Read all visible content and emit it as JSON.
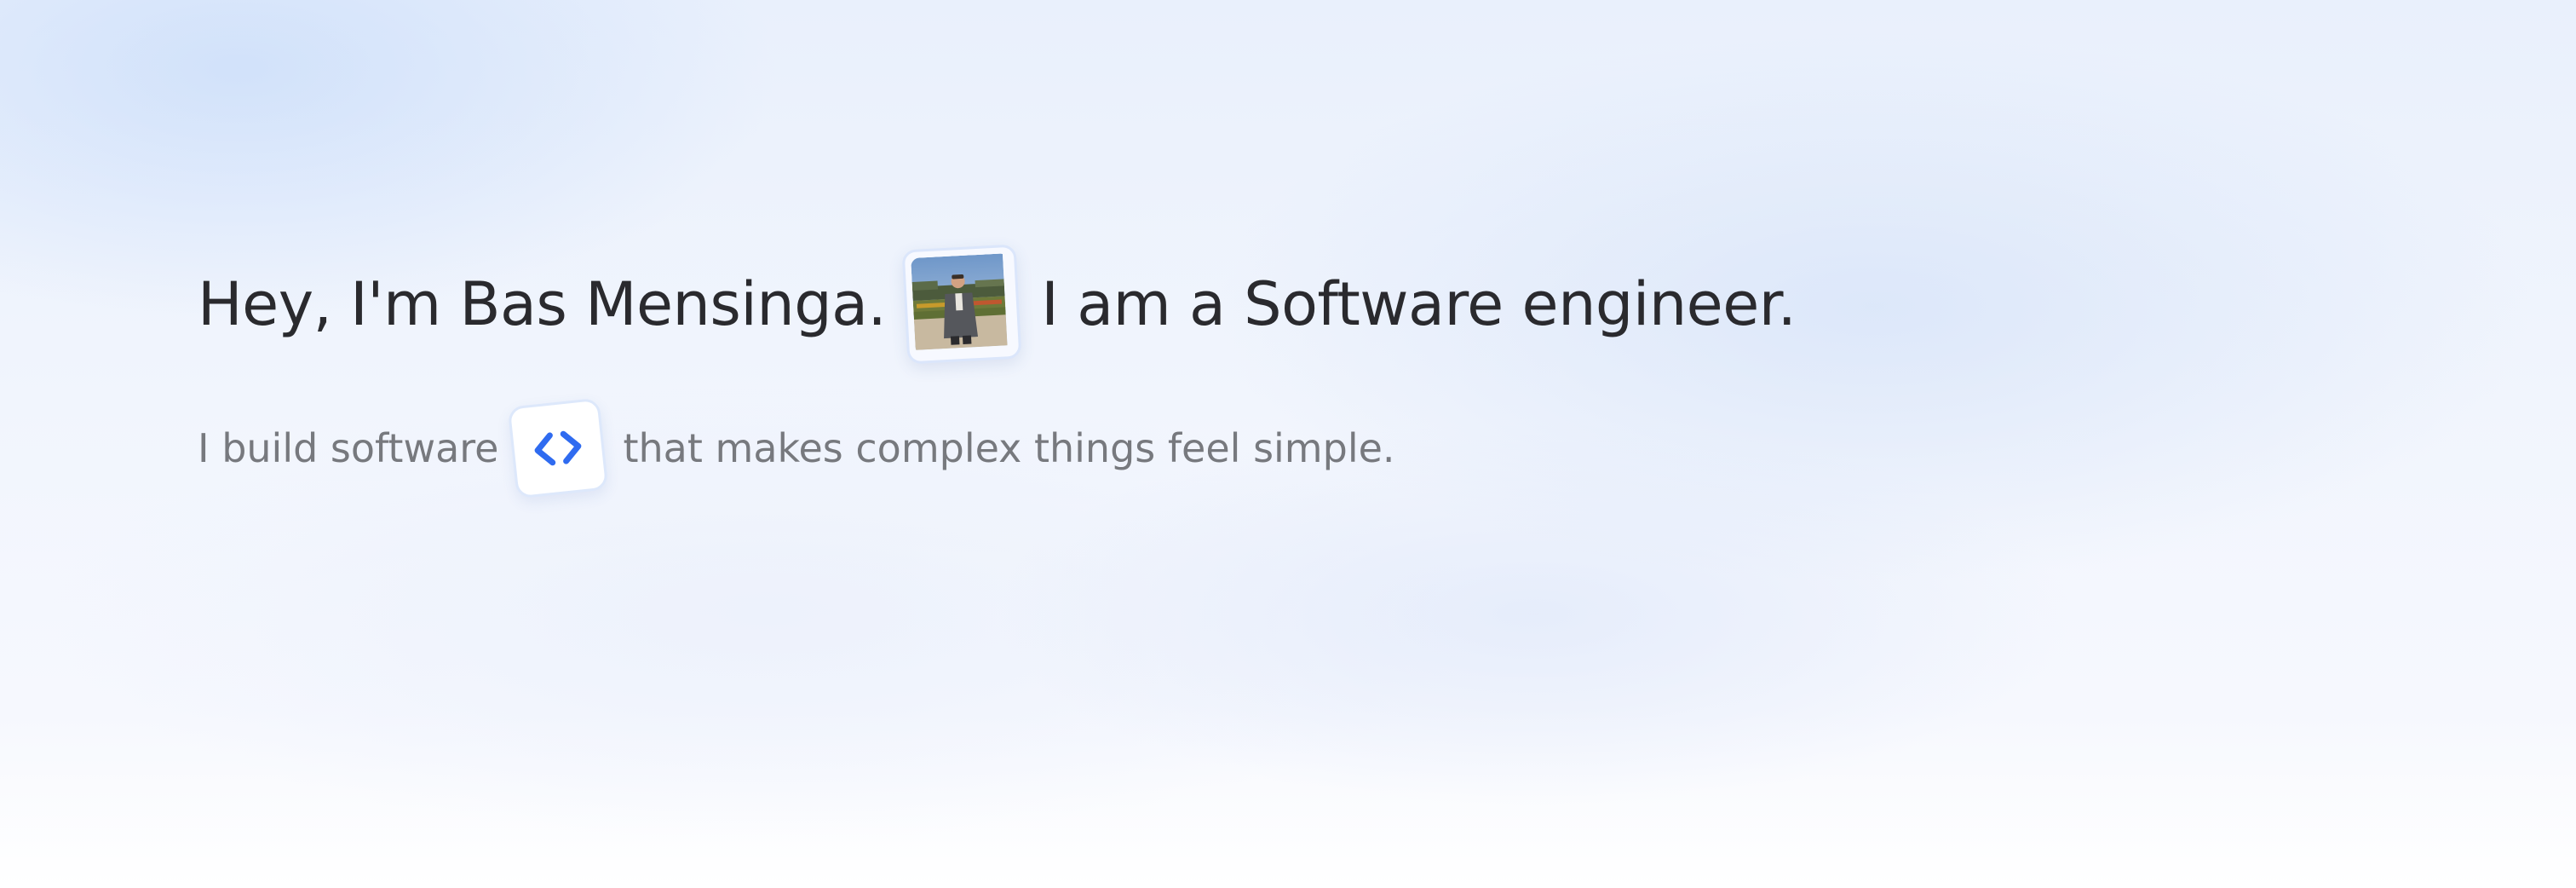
{
  "hero": {
    "greeting": "Hey, I'm Bas Mensinga.",
    "role": "I am a Software engineer.",
    "tagline_start": "I build software",
    "tagline_end": "that makes complex things feel simple.",
    "photo_icon": "profile-photo",
    "badge_icon": "code-brackets-icon"
  },
  "colors": {
    "heading": "#2a2a2e",
    "subtext": "#77797e",
    "accent": "#2f6bf0"
  }
}
